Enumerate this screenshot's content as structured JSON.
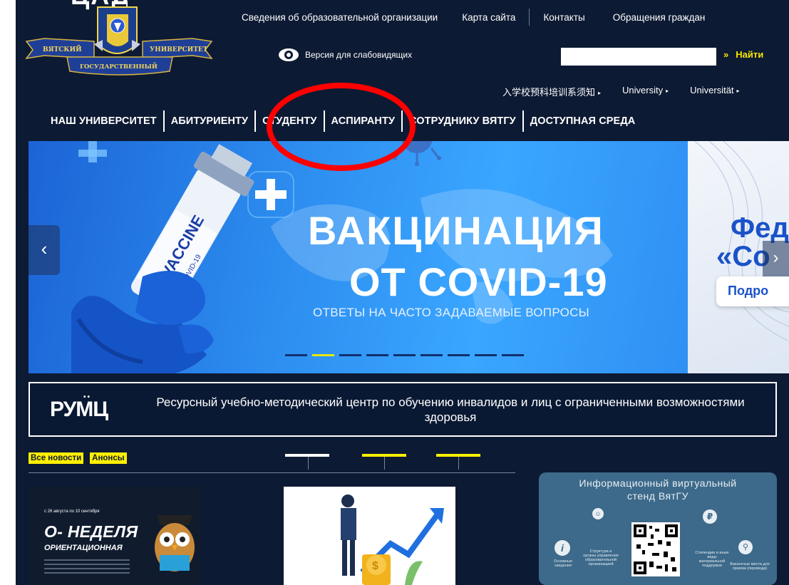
{
  "topbar": {
    "links": [
      "Сведения об образовательной организации",
      "Карта сайта",
      "Контакты",
      "Обращения граждан"
    ]
  },
  "logo": {
    "ribbon_left": "ВЯТСКИЙ",
    "ribbon_right": "УНИВЕРСИТЕТ",
    "ribbon_bottom": "ГОСУДАРСТВЕННЫЙ",
    "cropped_text": "ЦАД"
  },
  "accessibility": {
    "label": "Версия для слабовидящих",
    "icon": "eye-icon"
  },
  "search": {
    "value": "",
    "button_label": "Найти",
    "button_icon": "»"
  },
  "languages": [
    "入学校预科培训系须知",
    "University",
    "Universität"
  ],
  "main_nav": [
    "НАШ УНИВЕРСИТЕТ",
    "АБИТУРИЕНТУ",
    "СТУДЕНТУ",
    "АСПИРАНТУ",
    "СОТРУДНИКУ ВЯТГУ",
    "ДОСТУПНАЯ СРЕДА"
  ],
  "banner": {
    "title_line1": "ВАКЦИНАЦИЯ",
    "title_line2": "ОТ COVID-19",
    "subtitle": "ОТВЕТЫ НА ЧАСТО ЗАДАВАЕМЫЕ ВОПРОСЫ",
    "vial_text": "VACCINE",
    "vial_sub": "COVID-19",
    "side_line1": "Фед",
    "side_line2": "«Со",
    "side_button": "Подро",
    "dots_total": 9,
    "active_dot": 2,
    "prev_icon": "‹",
    "next_icon": "›"
  },
  "rumc": {
    "logo": "РУМЦ",
    "text": "Ресурсный учебно-методический центр по обучению инвалидов и лиц с ограниченными возможностями здоровья"
  },
  "news": {
    "tabs": [
      "Все новости",
      "Анонсы"
    ],
    "pager_colors": [
      "#ffffff",
      "#ffef00",
      "#ffef00"
    ],
    "card1": {
      "small": "с 26 августа по 10 сентября",
      "title": "О- НЕДЕЛЯ",
      "subtitle": "ОРИЕНТАЦИОННАЯ"
    }
  },
  "stand": {
    "title_line1": "Информационный виртуальный",
    "title_line2": "стенд ВятГУ",
    "labels": {
      "structure": "Структура и органы управления образовательной организацией",
      "basic": "Основные сведения",
      "stipend": "Стипендии и иные виды материальной поддержки",
      "vacancies": "Вакантные места для приема (перевода)"
    }
  },
  "colors": {
    "background": "#0d1a33",
    "accent_yellow": "#ffef00",
    "annotation_red": "#ff0000",
    "banner_blue": "#2d8ef0"
  }
}
